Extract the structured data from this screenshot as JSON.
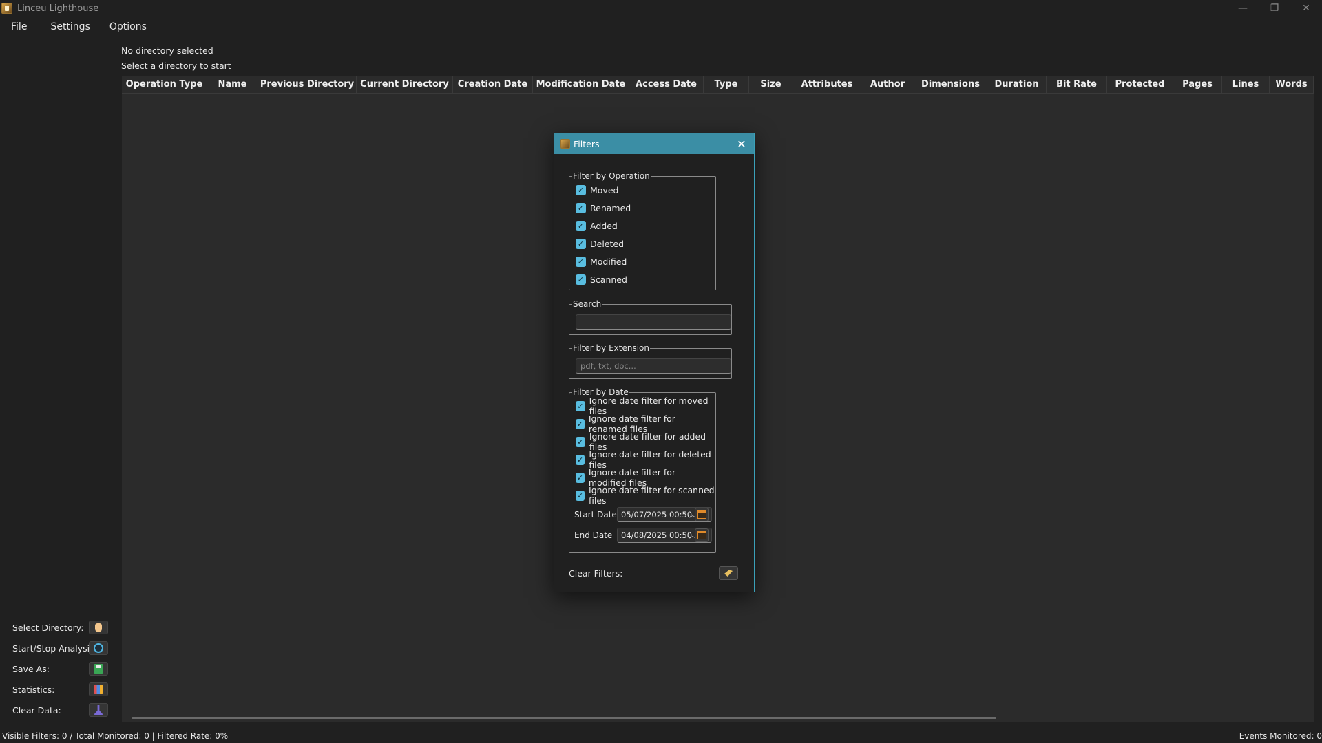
{
  "window": {
    "title": "Linceu Lighthouse",
    "controls": {
      "minimize": "—",
      "maximize": "❐",
      "close": "✕"
    }
  },
  "menu": [
    "File",
    "Settings",
    "Options"
  ],
  "directory": {
    "status": "No directory selected",
    "hint": "Select a directory to start"
  },
  "table": {
    "columns": [
      "Operation Type",
      "Name",
      "Previous Directory",
      "Current Directory",
      "Creation Date",
      "Modification Date",
      "Access Date",
      "Type",
      "Size",
      "Attributes",
      "Author",
      "Dimensions",
      "Duration",
      "Bit Rate",
      "Protected",
      "Pages",
      "Lines",
      "Words"
    ]
  },
  "actions": [
    {
      "label": "Select Directory:",
      "icon": "hand-pointer-icon"
    },
    {
      "label": "Start/Stop Analysis:",
      "icon": "play-circle-icon"
    },
    {
      "label": "Save As:",
      "icon": "save-icon"
    },
    {
      "label": "Statistics:",
      "icon": "statistics-icon"
    },
    {
      "label": "Clear Data:",
      "icon": "clear-data-icon"
    }
  ],
  "status": {
    "left": "Visible Filters: 0 / Total Monitored: 0 | Filtered Rate: 0%",
    "right": "Events Monitored: 0"
  },
  "filters_dialog": {
    "title": "Filters",
    "close": "✕",
    "operation": {
      "legend": "Filter by Operation",
      "options": [
        {
          "label": "Moved",
          "checked": true
        },
        {
          "label": "Renamed",
          "checked": true
        },
        {
          "label": "Added",
          "checked": true
        },
        {
          "label": "Deleted",
          "checked": true
        },
        {
          "label": "Modified",
          "checked": true
        },
        {
          "label": "Scanned",
          "checked": true
        }
      ]
    },
    "search": {
      "legend": "Search",
      "value": ""
    },
    "extension": {
      "legend": "Filter by Extension",
      "placeholder": "pdf, txt, doc..."
    },
    "date": {
      "legend": "Filter by Date",
      "options": [
        {
          "label": "Ignore date filter for moved files",
          "checked": true
        },
        {
          "label": "Ignore date filter for renamed files",
          "checked": true
        },
        {
          "label": "Ignore date filter for added files",
          "checked": true
        },
        {
          "label": "Ignore date filter for deleted files",
          "checked": true
        },
        {
          "label": "Ignore date filter for modified files",
          "checked": true
        },
        {
          "label": "Ignore date filter for scanned files",
          "checked": true
        }
      ],
      "start_label": "Start Date",
      "start_value": "05/07/2025 00:50",
      "end_label": "End Date",
      "end_value": "04/08/2025 00:50"
    },
    "clear_label": "Clear Filters:"
  },
  "colors": {
    "accent": "#59bde0",
    "dialog_title": "#3b8ea5",
    "background": "#202020",
    "table_background": "#2b2b2b"
  }
}
